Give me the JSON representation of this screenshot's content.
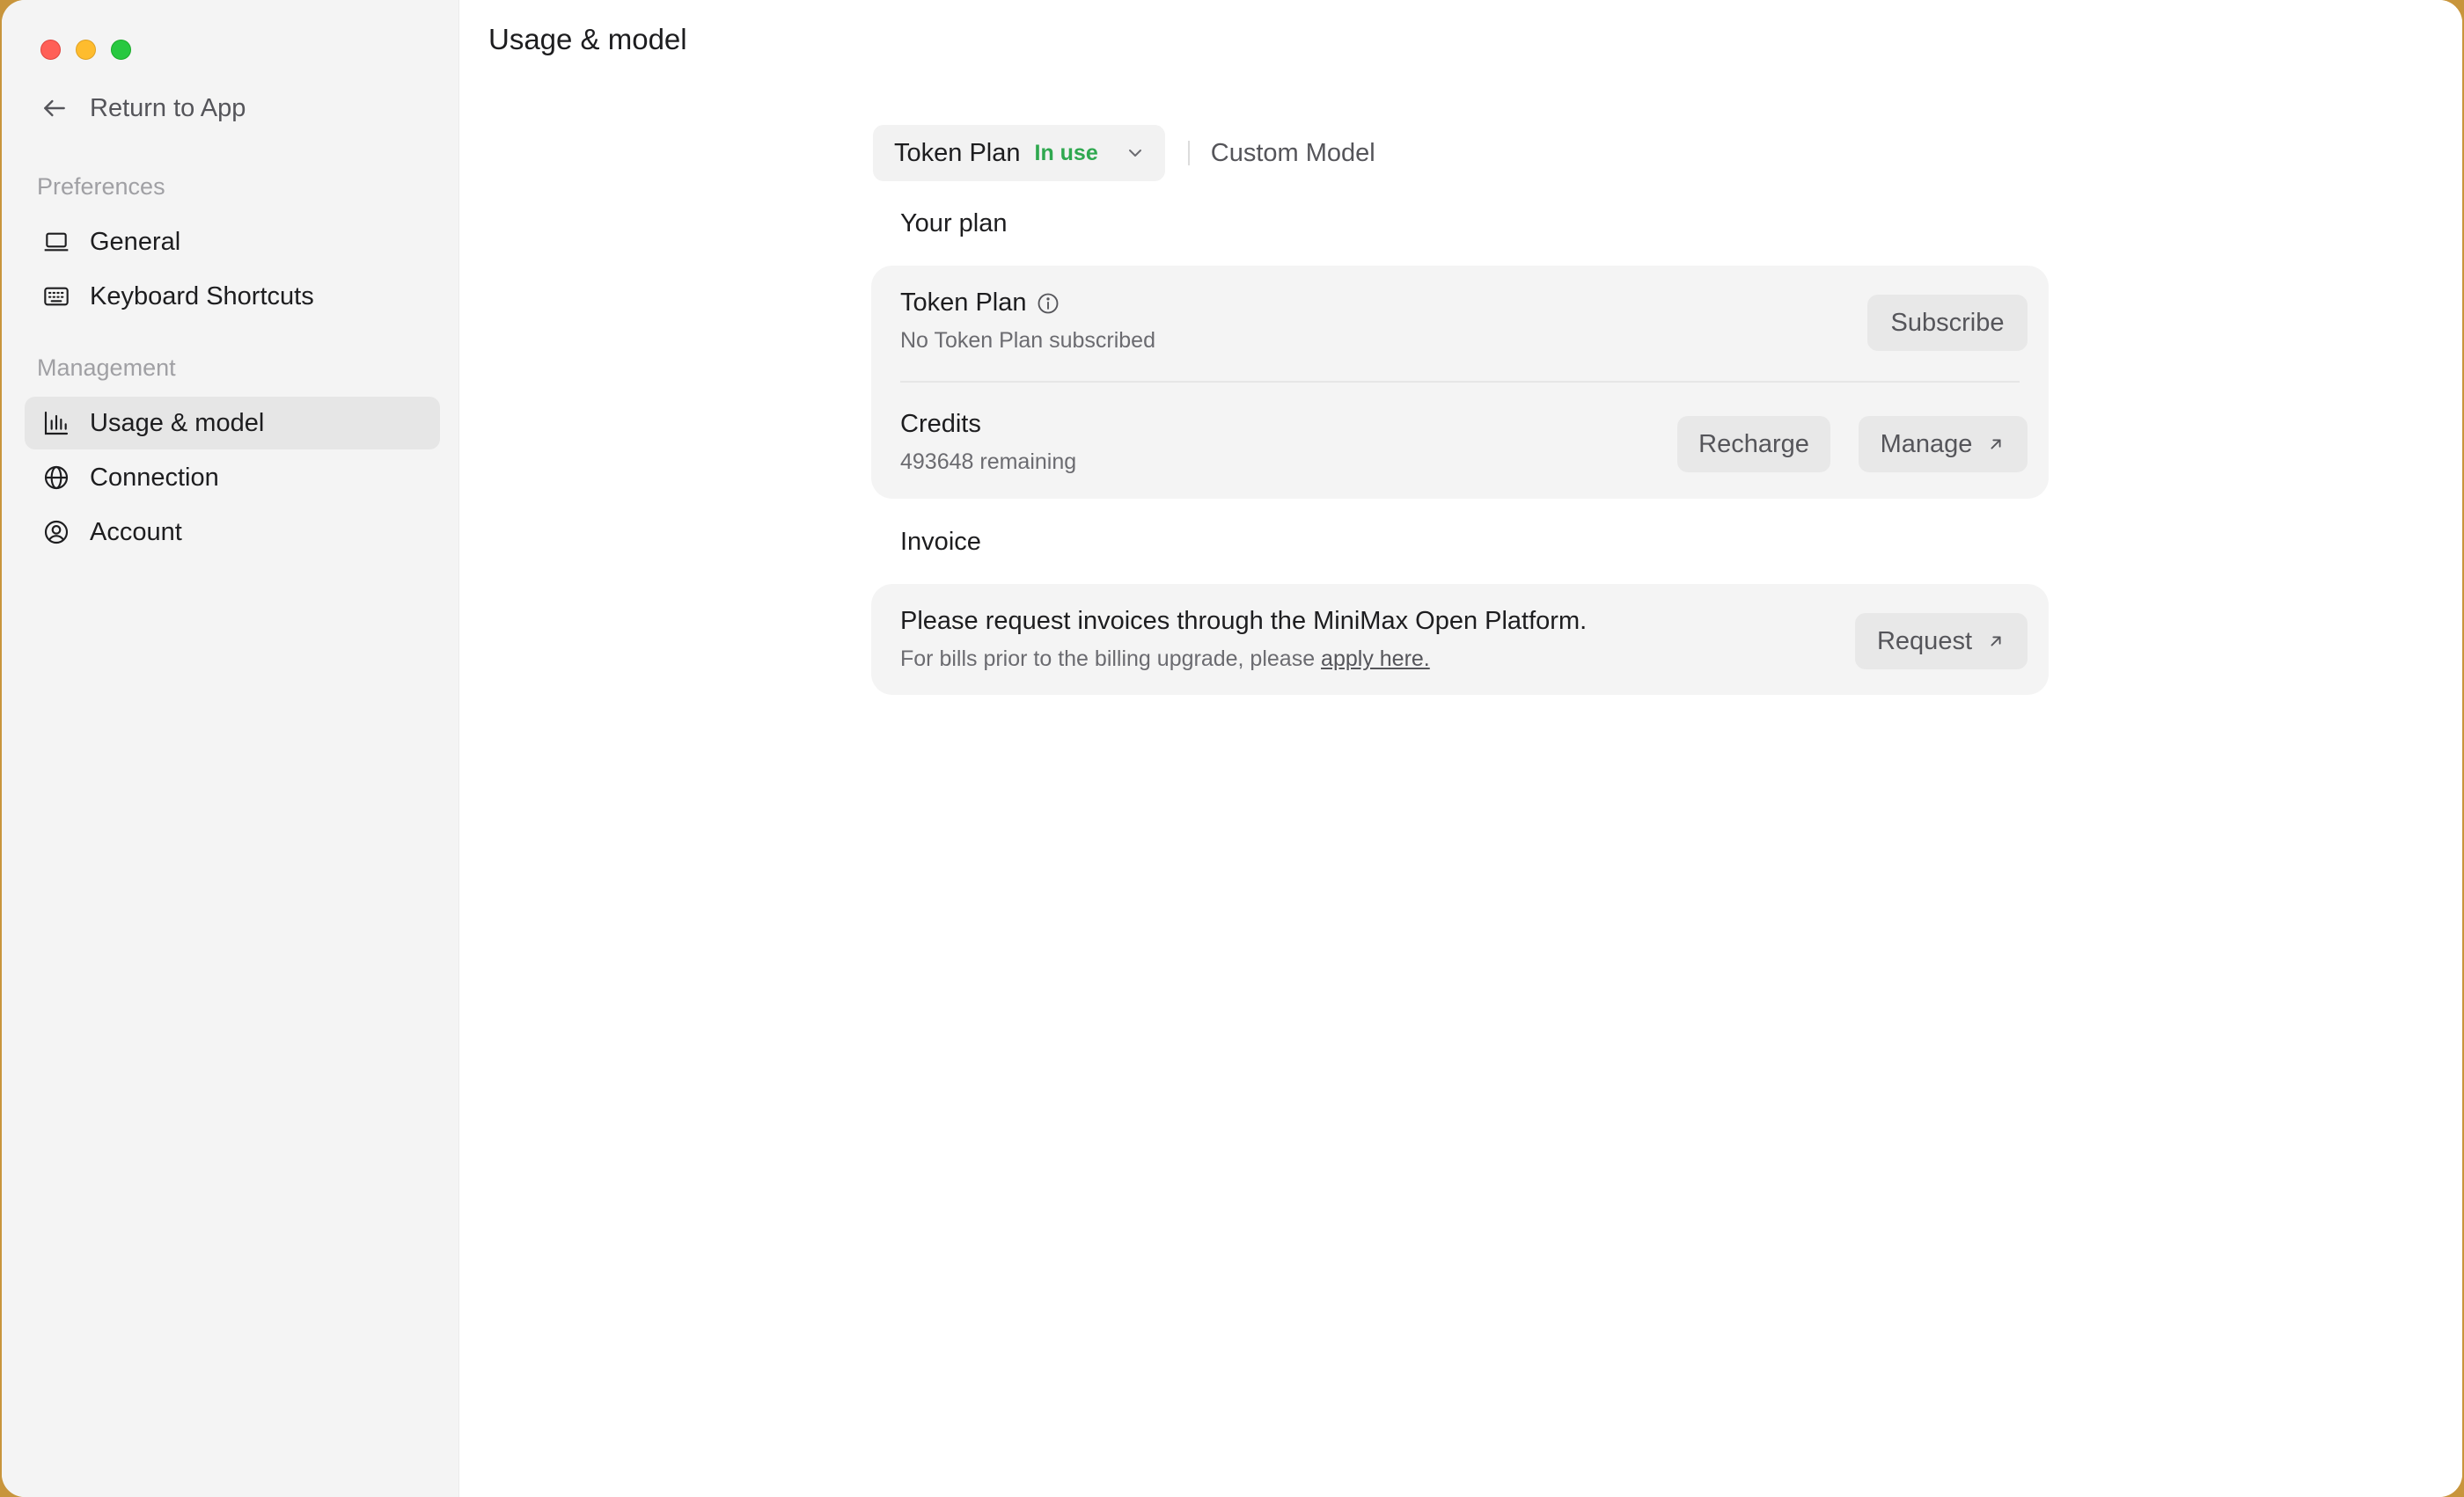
{
  "sidebar": {
    "return_label": "Return to App",
    "sections": {
      "preferences": "Preferences",
      "management": "Management"
    },
    "items": {
      "general": "General",
      "keyboard_shortcuts": "Keyboard Shortcuts",
      "usage_model": "Usage & model",
      "connection": "Connection",
      "account": "Account"
    },
    "active_item": "Usage & model"
  },
  "main": {
    "title": "Usage & model",
    "tabs": {
      "selected_label": "Token Plan",
      "selected_badge": "In use",
      "other_label": "Custom Model"
    },
    "your_plan": {
      "heading": "Your plan",
      "token_plan": {
        "title": "Token Plan",
        "status": "No Token Plan subscribed",
        "button": "Subscribe"
      },
      "credits": {
        "title": "Credits",
        "remaining": "493648 remaining",
        "recharge_button": "Recharge",
        "manage_button": "Manage"
      }
    },
    "invoice": {
      "heading": "Invoice",
      "text": "Please request invoices through the MiniMax Open Platform.",
      "sub_prefix": "For bills prior to the billing upgrade, please ",
      "sub_link": "apply here.",
      "button": "Request"
    }
  },
  "colors": {
    "in_use_badge": "#2fa84f",
    "sidebar_bg": "#f4f4f4",
    "card_bg": "#f4f4f4",
    "traffic_close": "#ff5f57",
    "traffic_minimize": "#febc2e",
    "traffic_maximize": "#28c840"
  }
}
